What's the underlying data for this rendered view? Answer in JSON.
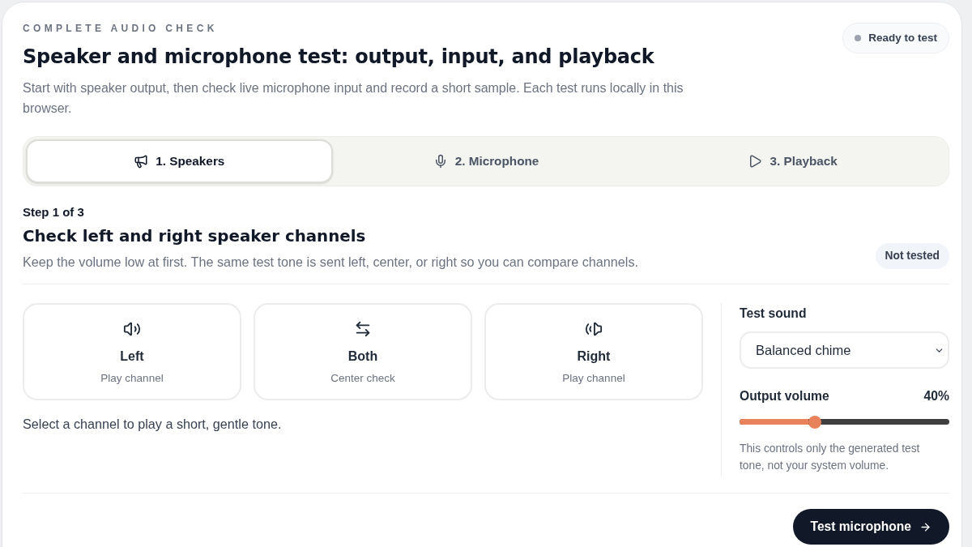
{
  "header": {
    "eyebrow": "COMPLETE AUDIO CHECK",
    "title": "Speaker and microphone test: output, input, and playback",
    "description": "Start with speaker output, then check live microphone input and record a short sample. Each test runs locally in this browser.",
    "status": "Ready to test"
  },
  "tabs": [
    {
      "label": "1. Speakers",
      "selected": true
    },
    {
      "label": "2. Microphone",
      "selected": false
    },
    {
      "label": "3. Playback",
      "selected": false
    }
  ],
  "step": {
    "counter": "Step 1 of 3",
    "title": "Check left and right speaker channels",
    "description": "Keep the volume low at first. The same test tone is sent left, center, or right so you can compare channels.",
    "status": "Not tested"
  },
  "channels": [
    {
      "label": "Left",
      "caption": "Play channel",
      "selected": false
    },
    {
      "label": "Both",
      "caption": "Center check",
      "selected": false
    },
    {
      "label": "Right",
      "caption": "Play channel",
      "selected": false
    }
  ],
  "hint": "Select a channel to play a short, gentle tone.",
  "settings": {
    "sound_label": "Test sound",
    "sound_value": "Balanced chime",
    "volume_label": "Output volume",
    "volume_reading": "40%",
    "volume": {
      "level": 0.35
    },
    "note": "This controls only the generated test tone, not your system volume."
  },
  "footer": {
    "button": "Test microphone"
  }
}
